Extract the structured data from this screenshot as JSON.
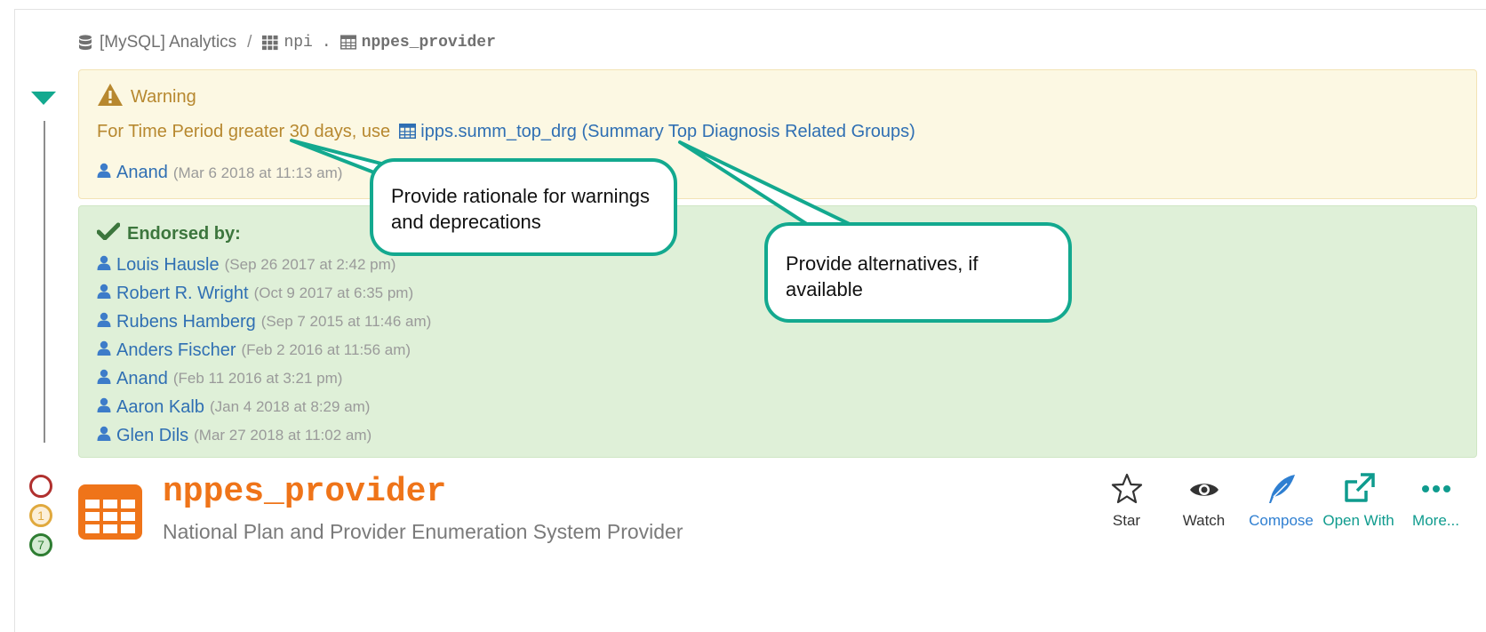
{
  "breadcrumb": {
    "datasource": "[MySQL] Analytics",
    "separator": "/",
    "schema": "npi",
    "dot": ".",
    "table": "nppes_provider"
  },
  "warning": {
    "title": "Warning",
    "text_prefix": "For Time Period greater 30 days, use",
    "link_text": "ipps.summ_top_drg (Summary Top Diagnosis Related Groups)",
    "author": "Anand",
    "timestamp": "(Mar 6 2018 at 11:13 am)"
  },
  "endorsed": {
    "title": "Endorsed by:",
    "rows": [
      {
        "name": "Louis Hausle",
        "timestamp": "(Sep 26 2017 at 2:42 pm)"
      },
      {
        "name": "Robert R. Wright",
        "timestamp": "(Oct 9 2017 at 6:35 pm)"
      },
      {
        "name": "Rubens Hamberg",
        "timestamp": "(Sep 7 2015 at 11:46 am)"
      },
      {
        "name": "Anders Fischer",
        "timestamp": "(Feb 2 2016 at 11:56 am)"
      },
      {
        "name": "Anand",
        "timestamp": "(Feb 11 2016 at 3:21 pm)"
      },
      {
        "name": "Aaron Kalb",
        "timestamp": "(Jan 4 2018 at 8:29 am)"
      },
      {
        "name": "Glen Dils",
        "timestamp": "(Mar 27 2018 at 11:02 am)"
      }
    ]
  },
  "callouts": {
    "rationale": "Provide rationale for warnings and deprecations",
    "alternatives": "Provide alternatives, if available"
  },
  "status": {
    "orange_count": "1",
    "green_count": "7"
  },
  "entity": {
    "title": "nppes_provider",
    "description": "National Plan and Provider Enumeration System Provider"
  },
  "actions": {
    "star": "Star",
    "watch": "Watch",
    "compose": "Compose",
    "open_with": "Open With",
    "more": "More..."
  },
  "colors": {
    "warning_bg": "#fcf8e3",
    "warning_text": "#b7882f",
    "endorsed_bg": "#dff0d8",
    "endorsed_text": "#3c763d",
    "link": "#2f6fb3",
    "callout_border": "#13a98f",
    "title_orange": "#ef7419"
  }
}
